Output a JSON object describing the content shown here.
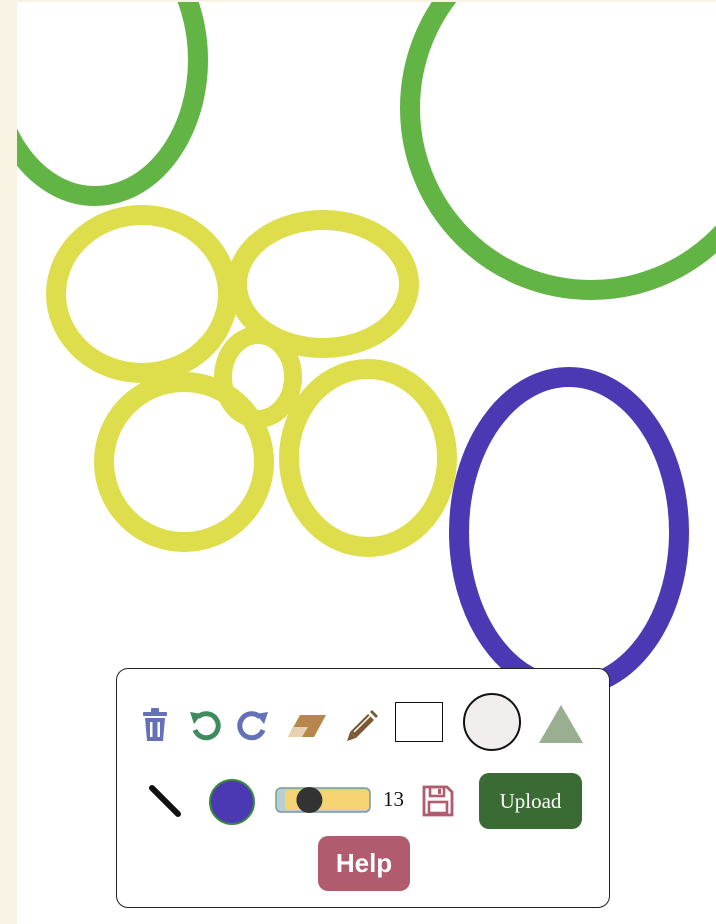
{
  "colors": {
    "page_background": "#f8f3e2",
    "green_stroke": "#62b445",
    "yellow_stroke": "#dede4c",
    "purple_stroke": "#4b38b3",
    "current_color": "#4b38b3",
    "upload_bg": "#3a6b34",
    "help_bg": "#b15b6f",
    "trash_icon": "#6470b8",
    "undo_icon": "#3e8c5e",
    "redo_icon": "#6470b8",
    "eraser_icon": "#b8864a",
    "pencil_icon": "#7a5a35",
    "triangle_tool": "#9aae92",
    "save_icon": "#b15b6f"
  },
  "canvas": {
    "shapes": [
      "ellipse",
      "ellipse",
      "ellipse",
      "ellipse",
      "ellipse",
      "ellipse",
      "ellipse",
      "ellipse"
    ]
  },
  "toolbar": {
    "icons": [
      "trash-icon",
      "undo-icon",
      "redo-icon",
      "eraser-icon",
      "pencil-icon",
      "rectangle-tool",
      "circle-tool",
      "triangle-tool",
      "line-tool",
      "color-picker",
      "brush-size-slider",
      "save-icon"
    ],
    "brush_size": "13",
    "brush_size_fraction": 0.3,
    "upload_label": "Upload",
    "help_label": "Help"
  }
}
